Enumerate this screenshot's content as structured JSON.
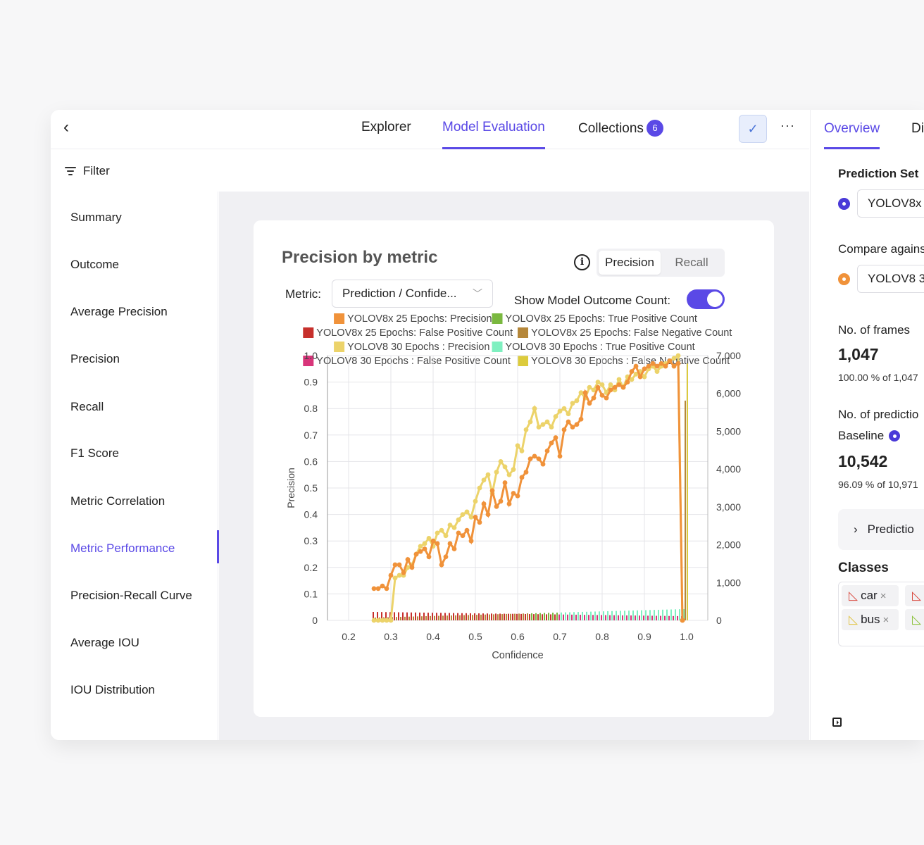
{
  "header": {
    "tabs": [
      {
        "label": "Explorer"
      },
      {
        "label": "Model Evaluation"
      },
      {
        "label": "Collections",
        "badge": "6"
      }
    ],
    "check_icon": "checkmark-icon",
    "more_label": "···"
  },
  "filter": {
    "label": "Filter"
  },
  "sidebar": {
    "items": [
      {
        "label": "Summary"
      },
      {
        "label": "Outcome"
      },
      {
        "label": "Average Precision"
      },
      {
        "label": "Precision"
      },
      {
        "label": "Recall"
      },
      {
        "label": "F1 Score"
      },
      {
        "label": "Metric Correlation"
      },
      {
        "label": "Metric Performance"
      },
      {
        "label": "Precision-Recall Curve"
      },
      {
        "label": "Average IOU"
      },
      {
        "label": "IOU Distribution"
      }
    ],
    "active": "Metric Performance"
  },
  "card": {
    "title": "Precision by metric",
    "segments": [
      "Precision",
      "Recall"
    ],
    "metric_label": "Metric:",
    "metric_value": "Prediction / Confide...",
    "toggle_label": "Show Model Outcome Count:",
    "toggle_on": true
  },
  "chart_data": {
    "type": "line",
    "xlabel": "Confidence",
    "ylabel": "Precision",
    "xlim": [
      0.15,
      1.05
    ],
    "ylim": [
      0,
      1.0
    ],
    "y2lim": [
      0,
      7000
    ],
    "x_ticks": [
      "0.2",
      "0.3",
      "0.4",
      "0.5",
      "0.6",
      "0.7",
      "0.8",
      "0.9",
      "1.0"
    ],
    "y_ticks": [
      "0",
      "0.1",
      "0.2",
      "0.3",
      "0.4",
      "0.5",
      "0.6",
      "0.7",
      "0.8",
      "0.9",
      "1.0"
    ],
    "y2_ticks": [
      "0",
      "1,000",
      "2,000",
      "3,000",
      "4,000",
      "5,000",
      "6,000",
      "7,000"
    ],
    "legend": [
      {
        "name": "YOLOV8x 25 Epochs: Precision",
        "color": "#f0923a"
      },
      {
        "name": "YOLOV8x 25 Epochs: True Positive Count",
        "color": "#7ab83f"
      },
      {
        "name": "YOLOV8x 25 Epochs: False Positive Count",
        "color": "#c7302c"
      },
      {
        "name": "YOLOV8x 25 Epochs: False Negative Count",
        "color": "#b5873a"
      },
      {
        "name": "YOLOV8 30 Epochs : Precision",
        "color": "#ecd36a"
      },
      {
        "name": "YOLOV8 30 Epochs : True Positive Count",
        "color": "#7ff0c0"
      },
      {
        "name": "YOLOV8 30 Epochs : False Positive Count",
        "color": "#d8357a"
      },
      {
        "name": "YOLOV8 30 Epochs : False Negative Count",
        "color": "#dccb3c"
      }
    ],
    "series": [
      {
        "name": "YOLOV8x 25 Epochs: Precision",
        "x": [
          0.26,
          0.27,
          0.28,
          0.29,
          0.3,
          0.31,
          0.32,
          0.33,
          0.34,
          0.35,
          0.36,
          0.37,
          0.38,
          0.39,
          0.4,
          0.41,
          0.42,
          0.43,
          0.44,
          0.45,
          0.46,
          0.47,
          0.48,
          0.49,
          0.5,
          0.51,
          0.52,
          0.53,
          0.54,
          0.55,
          0.56,
          0.57,
          0.58,
          0.59,
          0.6,
          0.61,
          0.62,
          0.63,
          0.64,
          0.65,
          0.66,
          0.67,
          0.68,
          0.69,
          0.7,
          0.71,
          0.72,
          0.73,
          0.74,
          0.75,
          0.76,
          0.77,
          0.78,
          0.79,
          0.8,
          0.81,
          0.82,
          0.83,
          0.84,
          0.85,
          0.86,
          0.87,
          0.88,
          0.89,
          0.9,
          0.91,
          0.92,
          0.93,
          0.94,
          0.95,
          0.96,
          0.97,
          0.98,
          0.99
        ],
        "values": [
          0.12,
          0.12,
          0.13,
          0.12,
          0.17,
          0.21,
          0.21,
          0.18,
          0.23,
          0.2,
          0.25,
          0.26,
          0.27,
          0.24,
          0.3,
          0.29,
          0.21,
          0.24,
          0.29,
          0.27,
          0.33,
          0.32,
          0.34,
          0.3,
          0.39,
          0.37,
          0.44,
          0.4,
          0.49,
          0.43,
          0.45,
          0.52,
          0.44,
          0.48,
          0.47,
          0.54,
          0.56,
          0.61,
          0.62,
          0.61,
          0.59,
          0.64,
          0.67,
          0.69,
          0.62,
          0.72,
          0.75,
          0.73,
          0.74,
          0.76,
          0.86,
          0.82,
          0.84,
          0.88,
          0.85,
          0.84,
          0.87,
          0.88,
          0.89,
          0.88,
          0.9,
          0.94,
          0.96,
          0.92,
          0.95,
          0.96,
          0.97,
          0.96,
          0.97,
          0.96,
          0.98,
          0.96,
          0.97,
          0.0
        ],
        "color": "#f0923a"
      },
      {
        "name": "YOLOV8 30 Epochs : Precision",
        "x": [
          0.26,
          0.27,
          0.28,
          0.29,
          0.3,
          0.31,
          0.32,
          0.33,
          0.34,
          0.35,
          0.36,
          0.37,
          0.38,
          0.39,
          0.4,
          0.41,
          0.42,
          0.43,
          0.44,
          0.45,
          0.46,
          0.47,
          0.48,
          0.49,
          0.5,
          0.51,
          0.52,
          0.53,
          0.54,
          0.55,
          0.56,
          0.57,
          0.58,
          0.59,
          0.6,
          0.61,
          0.62,
          0.63,
          0.64,
          0.65,
          0.66,
          0.67,
          0.68,
          0.69,
          0.7,
          0.71,
          0.72,
          0.73,
          0.74,
          0.75,
          0.76,
          0.77,
          0.78,
          0.79,
          0.8,
          0.81,
          0.82,
          0.83,
          0.84,
          0.85,
          0.86,
          0.87,
          0.88,
          0.89,
          0.9,
          0.91,
          0.92,
          0.93,
          0.94,
          0.95,
          0.96,
          0.97,
          0.98,
          0.99
        ],
        "values": [
          0.0,
          0.0,
          0.0,
          0.0,
          0.0,
          0.16,
          0.17,
          0.17,
          0.2,
          0.21,
          0.25,
          0.28,
          0.29,
          0.31,
          0.28,
          0.33,
          0.34,
          0.32,
          0.36,
          0.35,
          0.38,
          0.4,
          0.41,
          0.39,
          0.45,
          0.5,
          0.53,
          0.55,
          0.48,
          0.56,
          0.6,
          0.58,
          0.55,
          0.57,
          0.66,
          0.64,
          0.72,
          0.75,
          0.8,
          0.73,
          0.74,
          0.75,
          0.73,
          0.77,
          0.79,
          0.8,
          0.78,
          0.82,
          0.83,
          0.86,
          0.84,
          0.88,
          0.87,
          0.9,
          0.89,
          0.86,
          0.89,
          0.87,
          0.91,
          0.88,
          0.92,
          0.91,
          0.93,
          0.94,
          0.92,
          0.95,
          0.96,
          0.94,
          0.96,
          0.97,
          0.98,
          0.99,
          1.0,
          0.0
        ],
        "color": "#ecd36a"
      }
    ],
    "count_bars_note": "outcome counts drawn as small bars along bottom"
  },
  "right_panel": {
    "tabs": [
      {
        "label": "Overview"
      },
      {
        "label": "Di"
      }
    ],
    "prediction_set_label": "Prediction Set",
    "prediction_set_value": "YOLOV8x",
    "compare_label": "Compare agains",
    "compare_value": "YOLOV8 3",
    "frames_label": "No. of frames",
    "frames_value": "1,047",
    "frames_sub": "100.00 % of 1,047",
    "predictions_label": "No. of predictio",
    "baseline_label": "Baseline",
    "predictions_value": "10,542",
    "predictions_sub": "96.09 % of 10,971",
    "expander_label": "Predictio",
    "classes_label": "Classes",
    "classes": [
      {
        "label": "car",
        "color": "#d9463b"
      },
      {
        "label": "bus",
        "color": "#e0c23c"
      }
    ],
    "colors": {
      "primary": "#5a49e6",
      "compare": "#f0923a"
    }
  }
}
